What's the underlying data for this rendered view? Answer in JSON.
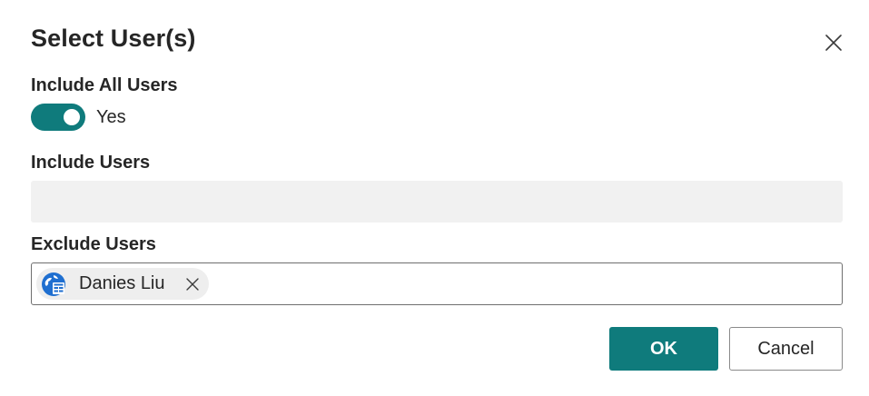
{
  "dialog": {
    "title": "Select User(s)",
    "close_icon": "close-icon"
  },
  "include_all": {
    "label": "Include All Users",
    "value_text": "Yes",
    "checked": true
  },
  "include_users": {
    "label": "Include Users",
    "value": ""
  },
  "exclude_users": {
    "label": "Exclude Users",
    "chips": [
      {
        "name": "Danies Liu",
        "icon": "user-globe-icon",
        "remove_icon": "close-icon"
      }
    ]
  },
  "buttons": {
    "ok_label": "OK",
    "cancel_label": "Cancel"
  },
  "colors": {
    "accent": "#0f7b7c",
    "input_disabled_bg": "#f1f1f1",
    "chip_bg": "#eeeeee",
    "avatar_blue": "#1f6fd0"
  }
}
